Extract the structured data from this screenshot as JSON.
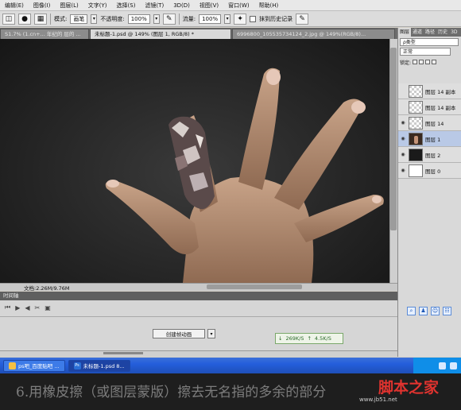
{
  "menu": [
    "编辑(E)",
    "图像(I)",
    "图层(L)",
    "文字(Y)",
    "选择(S)",
    "滤镜(T)",
    "3D(D)",
    "视图(V)",
    "窗口(W)",
    "帮助(H)"
  ],
  "options": {
    "mode_label": "模式:",
    "mode_value": "画笔",
    "opacity_label": "不透明度:",
    "opacity_value": "100%",
    "flow_label": "流量:",
    "flow_value": "100%",
    "history_label": "抹到历史记录"
  },
  "doc_tabs": [
    {
      "label": "S1.7% (1.cn+...  年纪的  层的 ...",
      "active": false
    },
    {
      "label": "未标题-1.psd @ 149% (图层 1, RGB/8) *",
      "active": true
    },
    {
      "label": "6996800_105535734124_2.jpg @ 149%(RGB/8)...",
      "active": false
    }
  ],
  "status": {
    "doc_info": "文档:2.26M/9.76M"
  },
  "timeline": {
    "header": "时间轴",
    "create_button": "创建帧动画",
    "down_speed": "269K/S",
    "up_speed": "4.5K/S"
  },
  "layers_panel": {
    "tabs": [
      "图层",
      "通道",
      "路径",
      "历史",
      "3D"
    ],
    "filter": "ρ类型",
    "blend_mode": "正常",
    "lock_label": "锁定:",
    "layers": [
      {
        "name": "图层 14 副本",
        "visible": false,
        "thumb": "transparent",
        "selected": false
      },
      {
        "name": "图层 14 副本",
        "visible": false,
        "thumb": "transparent",
        "selected": false
      },
      {
        "name": "图层 14",
        "visible": true,
        "thumb": "transparent",
        "selected": false
      },
      {
        "name": "图层 1",
        "visible": true,
        "thumb": "hand",
        "selected": true
      },
      {
        "name": "图层 2",
        "visible": true,
        "thumb": "black",
        "selected": false
      },
      {
        "name": "图层 0",
        "visible": true,
        "thumb": "white",
        "selected": false
      }
    ],
    "bottom_icons": [
      "link-icon",
      "person-icon",
      "user-icon",
      "group-icon"
    ]
  },
  "taskbar": {
    "items": [
      {
        "label": "ps吧_百度贴吧 ...",
        "active": false
      },
      {
        "label": "未标题-1.psd 8...",
        "active": true
      }
    ]
  },
  "caption": {
    "text": "6.用橡皮擦（或图层蒙版）擦去无名指的多余的部分",
    "watermark": "脚本之家",
    "watermark_sub": "www.jb51.net"
  }
}
